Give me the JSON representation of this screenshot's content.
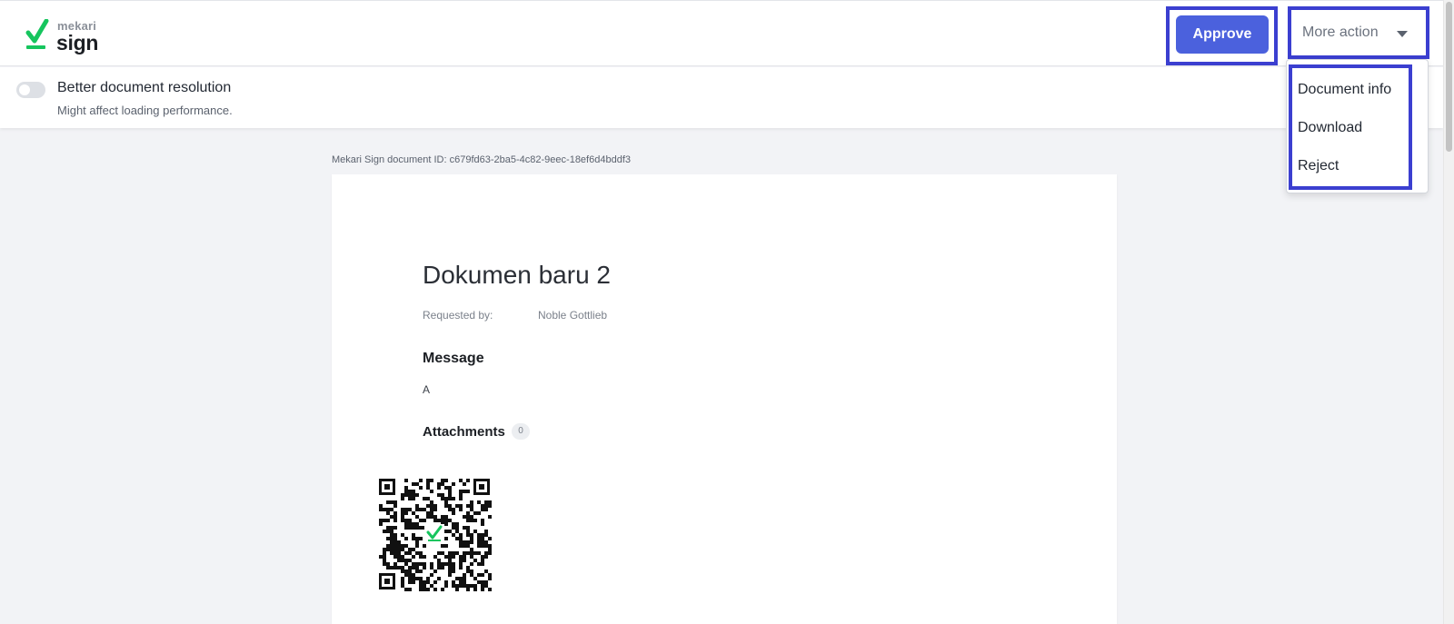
{
  "brand": {
    "company": "mekari",
    "product": "sign",
    "accent_color": "#16c55e"
  },
  "header": {
    "approve_label": "Approve",
    "more_action_label": "More action"
  },
  "toggle": {
    "label": "Better document resolution",
    "hint": "Might affect loading performance.",
    "enabled": false
  },
  "dropdown": {
    "items": [
      {
        "label": "Document info"
      },
      {
        "label": "Download"
      },
      {
        "label": "Reject"
      }
    ]
  },
  "document": {
    "id_text": "Mekari Sign document ID: c679fd63-2ba5-4c82-9eec-18ef6d4bddf3",
    "title": "Dokumen baru 2",
    "requested_by_label": "Requested by:",
    "requested_by_value": "Noble Gottlieb",
    "message_heading": "Message",
    "message_body": "A",
    "attachments_heading": "Attachments",
    "attachments_count": "0"
  },
  "colors": {
    "primary_button": "#4b61dd",
    "highlight_border": "#3b3fd0",
    "page_background": "#f2f3f6"
  }
}
